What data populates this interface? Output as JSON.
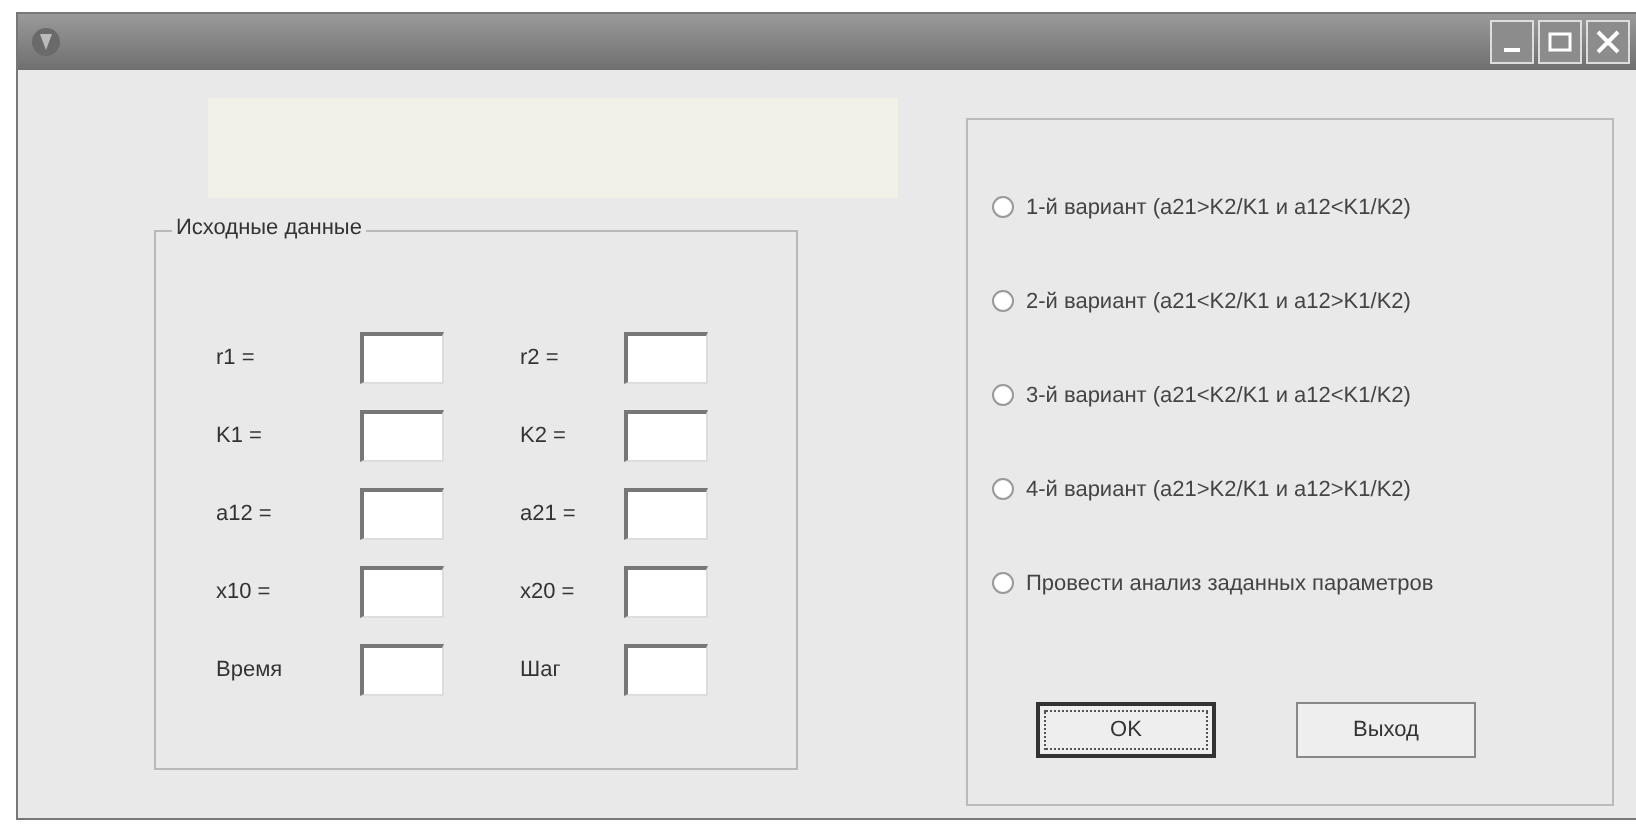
{
  "group": {
    "title": "Исходные данные",
    "fields": [
      {
        "label": "r1 ="
      },
      {
        "label": "r2 ="
      },
      {
        "label": "K1 ="
      },
      {
        "label": "K2 ="
      },
      {
        "label": "a12 ="
      },
      {
        "label": "a21 ="
      },
      {
        "label": "x10 ="
      },
      {
        "label": "x20 ="
      },
      {
        "label": "Время"
      },
      {
        "label": "Шаг"
      }
    ]
  },
  "options": [
    {
      "label": "1-й вариант (a21>K2/K1 и a12<K1/K2)",
      "selected": false
    },
    {
      "label": "2-й вариант (a21<K2/K1 и a12>K1/K2)",
      "selected": false
    },
    {
      "label": "3-й вариант (a21<K2/K1 и a12<K1/K2)",
      "selected": false
    },
    {
      "label": "4-й вариант (a21>K2/K1 и a12>K1/K2)",
      "selected": false
    },
    {
      "label": "Провести анализ заданных параметров",
      "selected": false
    }
  ],
  "buttons": [
    {
      "label": "OK",
      "kind": "default"
    },
    {
      "label": "Выход",
      "kind": "normal"
    }
  ]
}
